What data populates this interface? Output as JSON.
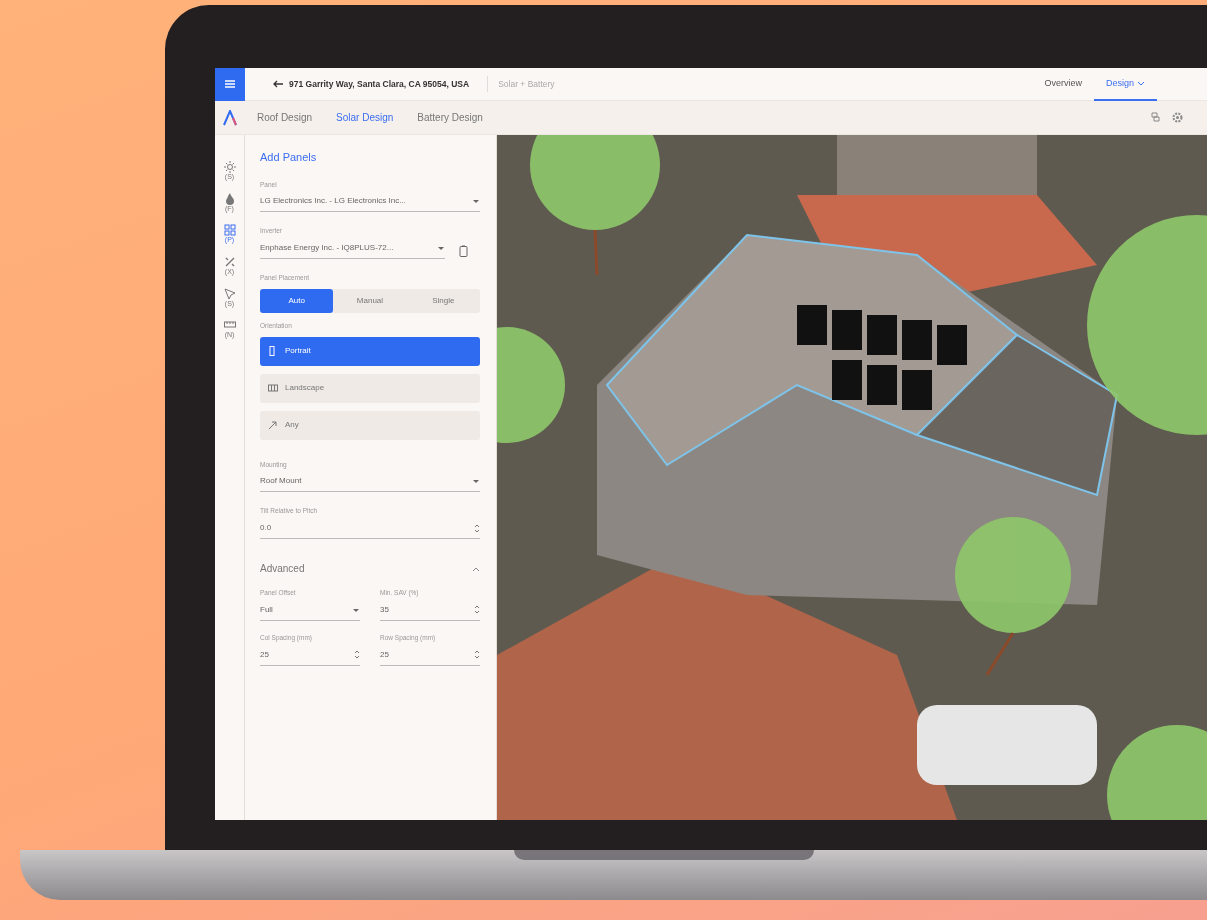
{
  "header": {
    "address": "971 Garrity Way, Santa Clara, CA 95054, USA",
    "project": "Solar + Battery",
    "nav": [
      {
        "label": "Overview",
        "selected": false
      },
      {
        "label": "Design",
        "selected": true
      }
    ]
  },
  "subtabs": [
    {
      "label": "Roof Design",
      "selected": false
    },
    {
      "label": "Solar Design",
      "selected": true
    },
    {
      "label": "Battery Design",
      "selected": false
    }
  ],
  "rail": [
    {
      "label": "(S)",
      "selected": false
    },
    {
      "label": "(F)",
      "selected": false
    },
    {
      "label": "(P)",
      "selected": true
    },
    {
      "label": "(X)",
      "selected": false
    },
    {
      "label": "(S)",
      "selected": false
    },
    {
      "label": "(N)",
      "selected": false
    }
  ],
  "panel": {
    "title": "Add Panels",
    "panel_field": {
      "label": "Panel",
      "value": "LG Electronics Inc. - LG Electronics Inc..."
    },
    "inverter_field": {
      "label": "Inverter",
      "value": "Enphase Energy Inc. - IQ8PLUS-72..."
    },
    "placement": {
      "label": "Panel Placement",
      "options": [
        {
          "label": "Auto",
          "selected": true
        },
        {
          "label": "Manual",
          "selected": false
        },
        {
          "label": "Single",
          "selected": false
        }
      ]
    },
    "orientation": {
      "label": "Orientation",
      "options": [
        {
          "label": "Portrait",
          "selected": true
        },
        {
          "label": "Landscape",
          "selected": false
        },
        {
          "label": "Any",
          "selected": false
        }
      ]
    },
    "mounting": {
      "label": "Mounting",
      "value": "Roof Mount"
    },
    "tilt": {
      "label": "Tilt Relative to Pitch",
      "value": "0.0"
    },
    "advanced": {
      "title": "Advanced",
      "expanded": true,
      "fields": [
        {
          "label": "Panel Offset",
          "value": "Full",
          "kind": "select"
        },
        {
          "label": "Min. SAV (%)",
          "value": "35",
          "kind": "number"
        },
        {
          "label": "Col Spacing (mm)",
          "value": "25",
          "kind": "number"
        },
        {
          "label": "Row Spacing (mm)",
          "value": "25",
          "kind": "number"
        }
      ]
    }
  }
}
